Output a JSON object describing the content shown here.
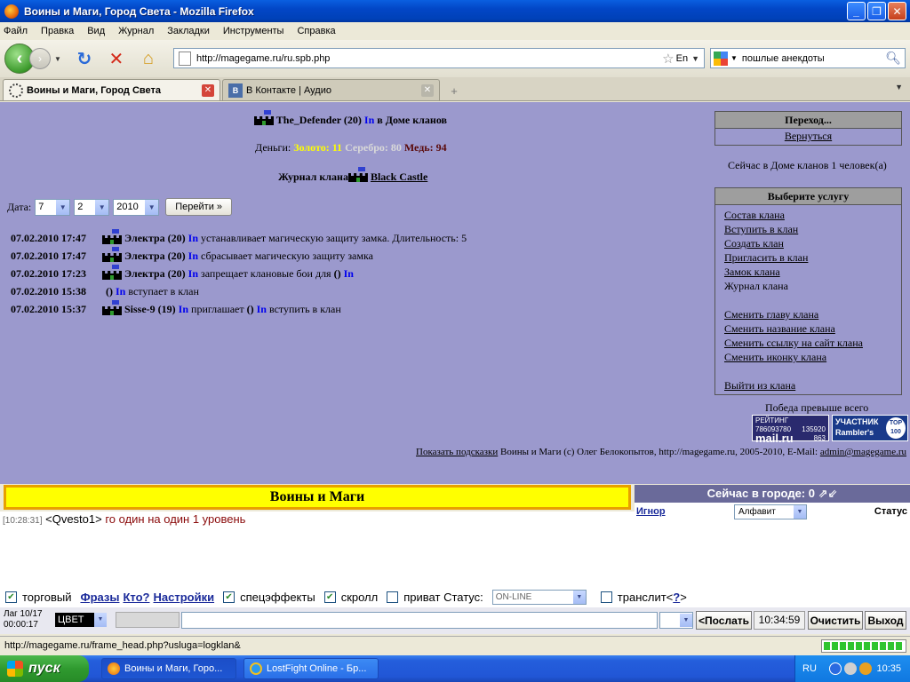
{
  "window": {
    "title": "Воины и Маги, Город Света - Mozilla Firefox",
    "min": "_",
    "max": "❐",
    "close": "✕"
  },
  "menu": [
    "Файл",
    "Правка",
    "Вид",
    "Журнал",
    "Закладки",
    "Инструменты",
    "Справка"
  ],
  "nav": {
    "url": "http://magegame.ru/ru.spb.php",
    "lang": "En",
    "search_value": "пошлые анекдоты"
  },
  "tabs": [
    {
      "label": "Воины и Маги, Город Света",
      "active": true
    },
    {
      "label": "В Контакте | Аудио",
      "active": false
    }
  ],
  "page": {
    "player": {
      "name": "The_Defender",
      "level": "(20)",
      "in": "In",
      "location": "в Доме кланов"
    },
    "money": {
      "label": "Деньги:",
      "gold": "Золото: 11",
      "silver": "Серебро: 80",
      "copper": "Медь: 94"
    },
    "journal": {
      "label": "Журнал клана",
      "clan": "Black Castle"
    },
    "date_filter": {
      "label": "Дата:",
      "day": "7",
      "month": "2",
      "year": "2010",
      "go": "Перейти »"
    },
    "log": [
      {
        "ts": "07.02.2010 17:47",
        "castle": true,
        "nick": "Электра (20)",
        "in": "In",
        "text": "устанавливает магическую защиту замка. Длительность: 5"
      },
      {
        "ts": "07.02.2010 17:47",
        "castle": true,
        "nick": "Электра (20)",
        "in": "In",
        "text": "сбрасывает магическую защиту замка"
      },
      {
        "ts": "07.02.2010 17:23",
        "castle": true,
        "nick": "Электра (20)",
        "in": "In",
        "text": "запрещает клановые бои для",
        "nick2": "()",
        "in2": "In"
      },
      {
        "ts": "07.02.2010 15:38",
        "castle": false,
        "nick": "()",
        "in": "In",
        "text": "вступает в клан"
      },
      {
        "ts": "07.02.2010 15:37",
        "castle": true,
        "nick": "Sisse-9 (19)",
        "in": "In",
        "text": "приглашает",
        "nick2": "()",
        "in2": "In",
        "text2": "вступить в клан"
      }
    ],
    "transition": {
      "header": "Переход...",
      "back": "Вернуться"
    },
    "online": "Сейчас в Доме кланов 1 человек(а)",
    "services": {
      "header": "Выберите услугу",
      "items": [
        "Состав клана",
        "Вступить в клан",
        "Создать клан",
        "Пригласить в клан",
        "Замок клана",
        "Журнал клана",
        "",
        "Сменить главу клана",
        "Сменить название клана",
        "Сменить ссылку на сайт клана",
        "Сменить иконку клана",
        "",
        "Выйти из клана"
      ]
    },
    "victory": "Победа превыше всего",
    "banner_mail": {
      "line1": "РЕЙТИНГ 786093780",
      "logo": "mail.ru",
      "n1": "135920",
      "n2": "863"
    },
    "banner_rambler": {
      "line1": "УЧАСТНИК",
      "logo": "Rambler's",
      "top": "TOP 100"
    },
    "footer": {
      "hints": "Показать подсказки",
      "copyright": "Воины и Маги (c) Олег Белокопытов, http://magegame.ru, 2005-2010, E-Mail:",
      "email": "admin@magegame.ru"
    }
  },
  "chat": {
    "title": "Воины и Маги",
    "message": {
      "time": "[10:28:31]",
      "who": "<Qvesto1>",
      "text": "го один на один 1 уровень"
    },
    "town": {
      "header": "Сейчас в городе: 0",
      "ignore": "Игнор",
      "sort": "Алфавит",
      "status": "Статус"
    },
    "options": {
      "trade": "торговый",
      "phrases": "Фразы",
      "who": "Кто?",
      "settings": "Настройки",
      "effects": "спецэффекты",
      "scroll": "скролл",
      "private": "приват",
      "status_label": "Статус:",
      "status_value": "ON-LINE",
      "translit": "транслит<",
      "help": "?",
      "after": ">"
    },
    "input": {
      "lag": "Лаг 10/17",
      "lag_time": "00:00:17",
      "color": "ЦВЕТ",
      "send": "<Послать",
      "clock": "10:34:59",
      "clear": "Очистить",
      "exit": "Выход"
    }
  },
  "statusbar": "http://magegame.ru/frame_head.php?usluga=logklan&",
  "taskbar": {
    "start": "пуск",
    "tasks": [
      "Воины и Маги, Горо...",
      "LostFight Online - Бр..."
    ],
    "lang": "RU",
    "clock": "10:35"
  }
}
